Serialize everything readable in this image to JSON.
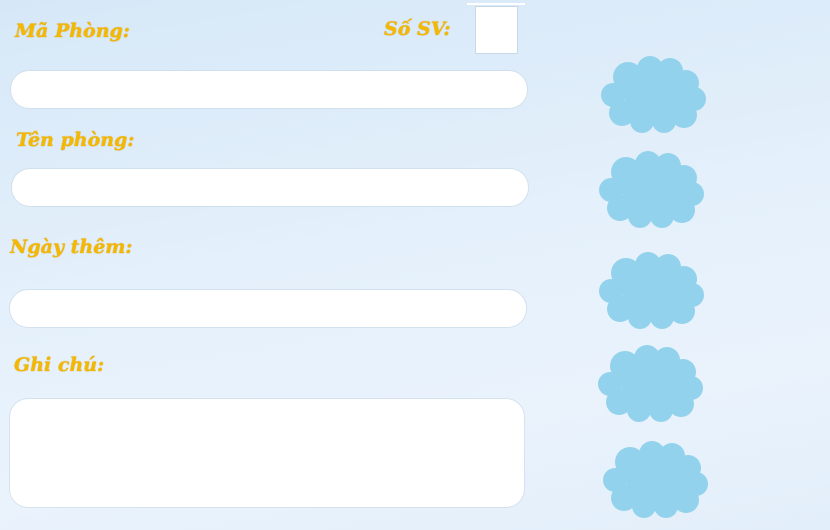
{
  "form": {
    "room_id_label": "Mã Phòng:",
    "room_id_value": "",
    "student_count_label": "Số SV:",
    "student_count_value": "",
    "room_name_label": "Tên phòng:",
    "room_name_value": "",
    "date_added_label": "Ngày thêm:",
    "date_added_value": "",
    "note_label": "Ghi chú:",
    "note_value": ""
  },
  "actions": {
    "button_icon": "cloud-icon",
    "button_color": "#93d2ec",
    "count": 5
  },
  "colors": {
    "label": "#f5b800",
    "background": "#e4f0fb"
  }
}
